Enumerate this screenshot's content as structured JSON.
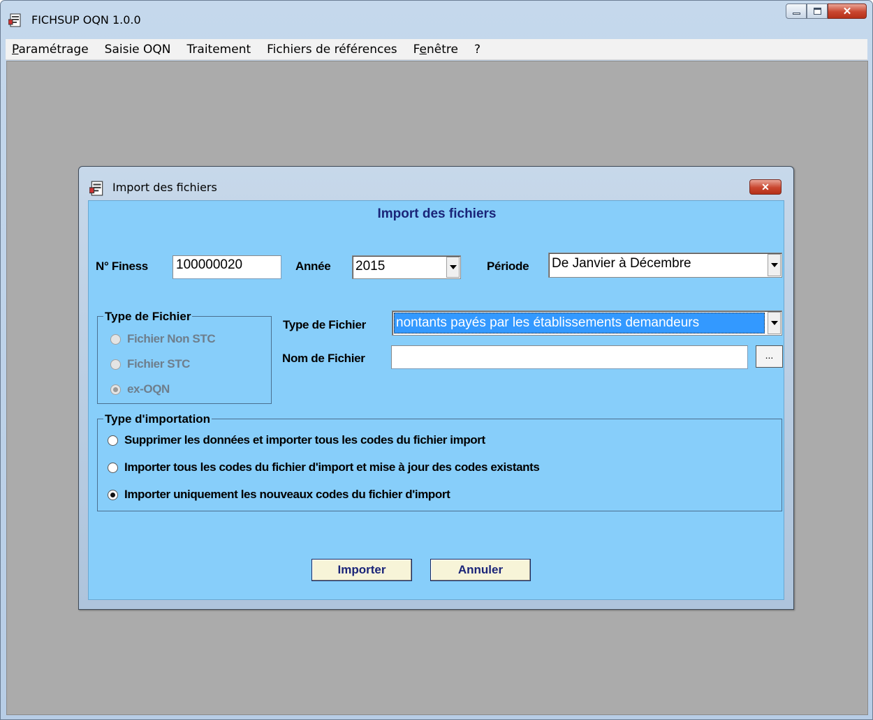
{
  "window": {
    "title": "FICHSUP OQN 1.0.0",
    "icon": "app-document-icon",
    "controls": {
      "minimize": "minimize-icon",
      "maximize": "maximize-icon",
      "close": "✕"
    }
  },
  "menu": {
    "items": [
      {
        "label": "Paramétrage",
        "underline": "P",
        "rest": "aramétrage"
      },
      {
        "label": "Saisie OQN"
      },
      {
        "label": "Traitement"
      },
      {
        "label": "Fichiers de références"
      },
      {
        "label": "Fenêtre",
        "pre": "F",
        "underline": "e",
        "rest": "nêtre"
      },
      {
        "label": "?"
      }
    ]
  },
  "dialog": {
    "title": "Import des fichiers",
    "close": "✕",
    "heading": "Import des fichiers",
    "finess": {
      "label": "N° Finess",
      "value": "100000020"
    },
    "annee": {
      "label": "Année",
      "value": "2015"
    },
    "periode": {
      "label": "Période",
      "value": "De Janvier à Décembre"
    },
    "type_group": {
      "title": "Type de Fichier",
      "options": [
        {
          "label": "Fichier Non STC",
          "checked": false
        },
        {
          "label": "Fichier STC",
          "checked": false
        },
        {
          "label": "ex-OQN",
          "checked": true
        }
      ]
    },
    "type_fichier": {
      "label": "Type de Fichier",
      "value": "nontants payés par les établissements demandeurs"
    },
    "nom_fichier": {
      "label": "Nom de Fichier",
      "value": "",
      "browse": "..."
    },
    "import_group": {
      "title": "Type d'importation",
      "options": [
        {
          "label": "Supprimer les données et importer tous les codes du fichier import",
          "checked": false
        },
        {
          "label": "Importer tous les codes du fichier d'import et mise à jour des codes existants",
          "checked": false
        },
        {
          "label": "Importer uniquement les nouveaux codes du fichier d'import",
          "checked": true
        }
      ]
    },
    "buttons": {
      "import": "Importer",
      "cancel": "Annuler"
    }
  }
}
